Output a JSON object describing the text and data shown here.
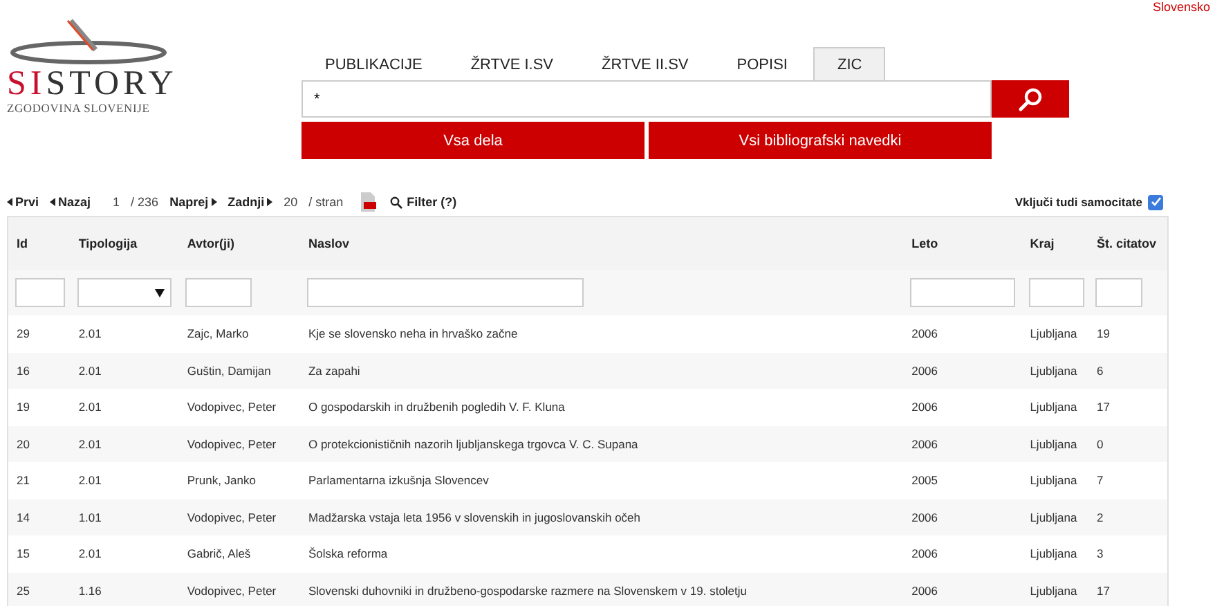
{
  "language_link": "Slovensko",
  "logo": {
    "title_accent": "SI",
    "title_rest": "STORY",
    "subtitle": "ZGODOVINA SLOVENIJE"
  },
  "tabs": [
    {
      "label": "PUBLIKACIJE",
      "selected": false
    },
    {
      "label": "ŽRTVE I.SV",
      "selected": false
    },
    {
      "label": "ŽRTVE II.SV",
      "selected": false
    },
    {
      "label": "POPISI",
      "selected": false
    },
    {
      "label": "ZIC",
      "selected": true
    }
  ],
  "search": {
    "value": "*"
  },
  "action_buttons": [
    "Vsa dela",
    "Vsi bibliografski navedki"
  ],
  "pager": {
    "first": "Prvi",
    "prev": "Nazaj",
    "page": "1",
    "total": "/ 236",
    "next": "Naprej",
    "last": "Zadnji",
    "per_page": "20",
    "per_page_label": "/ stran",
    "filter": "Filter (?)"
  },
  "self_citations": {
    "label": "Vključi tudi samocitate",
    "checked": true
  },
  "table": {
    "columns": [
      {
        "label": "Id",
        "kind": "text"
      },
      {
        "label": "Tipologija",
        "kind": "select"
      },
      {
        "label": "Avtor(ji)",
        "kind": "text"
      },
      {
        "label": "Naslov",
        "kind": "text"
      },
      {
        "label": "Leto",
        "kind": "text"
      },
      {
        "label": "Kraj",
        "kind": "text"
      },
      {
        "label": "Št. citatov",
        "kind": "text"
      }
    ],
    "rows": [
      [
        "29",
        "2.01",
        "Zajc, Marko",
        "Kje se slovensko neha in hrvaško začne",
        "2006",
        "Ljubljana",
        "19"
      ],
      [
        "16",
        "2.01",
        "Guštin, Damijan",
        "Za zapahi",
        "2006",
        "Ljubljana",
        "6"
      ],
      [
        "19",
        "2.01",
        "Vodopivec, Peter",
        "O gospodarskih in družbenih pogledih V. F. Kluna",
        "2006",
        "Ljubljana",
        "17"
      ],
      [
        "20",
        "2.01",
        "Vodopivec, Peter",
        "O protekcionističnih nazorih ljubljanskega trgovca V. C. Supana",
        "2006",
        "Ljubljana",
        "0"
      ],
      [
        "21",
        "2.01",
        "Prunk, Janko",
        "Parlamentarna izkušnja Slovencev",
        "2005",
        "Ljubljana",
        "7"
      ],
      [
        "14",
        "1.01",
        "Vodopivec, Peter",
        "Madžarska vstaja leta 1956 v slovenskih in jugoslovanskih očeh",
        "2006",
        "Ljubljana",
        "2"
      ],
      [
        "15",
        "2.01",
        "Gabrič, Aleš",
        "Šolska reforma",
        "2006",
        "Ljubljana",
        "3"
      ],
      [
        "25",
        "1.16",
        "Vodopivec, Peter",
        "Slovenski duhovniki in družbeno-gospodarske razmere na Slovenskem v 19. stoletju",
        "2006",
        "Ljubljana",
        "17"
      ]
    ]
  }
}
